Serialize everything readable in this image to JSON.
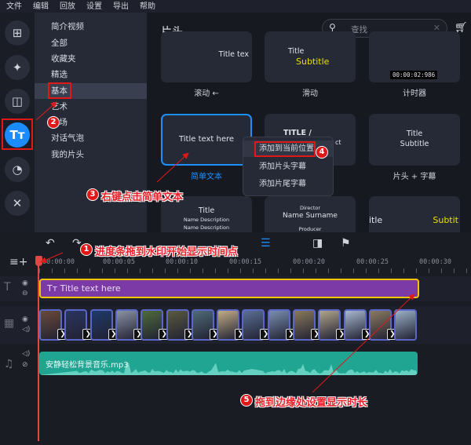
{
  "menu": [
    "文件",
    "编辑",
    "回放",
    "设置",
    "导出",
    "帮助"
  ],
  "sidebar_icons": [
    "add-media-icon",
    "magic-wand-icon",
    "transitions-icon",
    "titles-icon",
    "stickers-icon",
    "tools-icon"
  ],
  "categories": [
    "简介视频",
    "全部",
    "收藏夹",
    "精选",
    "基本",
    "艺术",
    "开场",
    "对话气泡",
    "我的片头"
  ],
  "selected_category": "基本",
  "panel": {
    "title": "片头",
    "search_placeholder": "查找"
  },
  "cards": [
    {
      "preview": "Title tex",
      "label": "滚动 ←"
    },
    {
      "preview": "Title",
      "preview2": "Subtitle",
      "label": "滑动"
    },
    {
      "preview": "00:00:02:986",
      "label": "计时器"
    },
    {
      "preview": "Title text here",
      "label": "简单文本"
    },
    {
      "preview": "TITLE /",
      "preview2": "ct",
      "label": ""
    },
    {
      "preview": "Title",
      "preview2": "Subtitle",
      "label": "片头 + 字幕"
    },
    {
      "preview": "Title",
      "preview2": "Name Description",
      "preview3": "Name Description"
    },
    {
      "preview": "Director",
      "preview2": "Name Surname",
      "preview3": "Producer"
    },
    {
      "preview": "itle",
      "preview2": "Subtit"
    }
  ],
  "context_menu": [
    "添加到当前位置",
    "添加片头字幕",
    "添加片尾字幕"
  ],
  "ruler": [
    "00:00:00",
    "00:00:05",
    "00:00:10",
    "00:00:15",
    "00:00:20",
    "00:00:25",
    "00:00:30"
  ],
  "title_clip": "Title text here",
  "audio_clip": "安静轻松背景音乐.mp3",
  "video_thumb_colors": [
    "#6b4a3a",
    "#2a3560",
    "#1d3a6a",
    "#8a93a5",
    "#4d6b3a",
    "#5a5a40",
    "#4f6a78",
    "#c2ad86",
    "#5a6f95",
    "#7a8fb0",
    "#8a7a5a",
    "#b0a58a",
    "#a8b8d0",
    "#8a7a60",
    "#9ab0c8"
  ],
  "annotations": {
    "a1": "进度条拖到水印开始显示时间点",
    "a3": "右键点击简单文本",
    "a5": "拖到边缘处设置显示时长",
    "n1": "1",
    "n2": "2",
    "n3": "3",
    "n4": "4",
    "n5": "5"
  },
  "colors": {
    "accent": "#1d8fff",
    "title_clip": "#7b3aa5",
    "audio_clip": "#1fa592",
    "playhead": "#e04848"
  }
}
